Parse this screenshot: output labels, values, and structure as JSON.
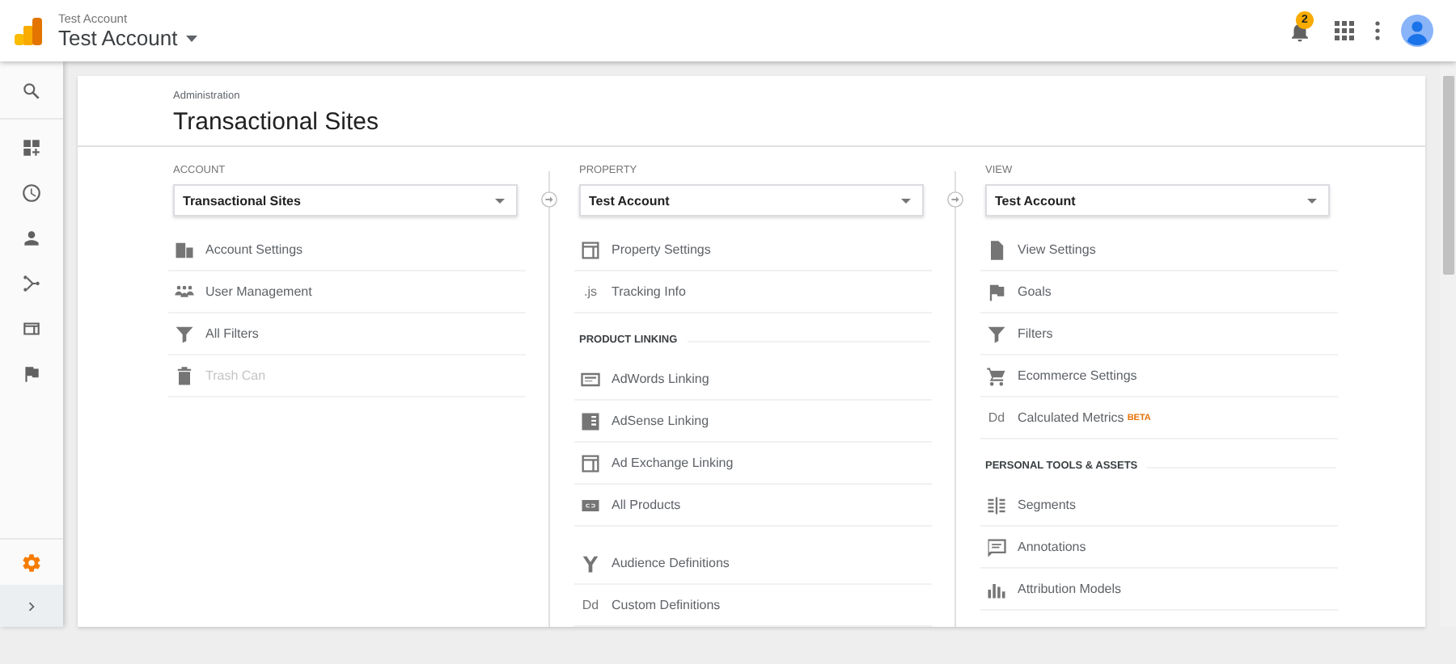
{
  "header": {
    "account_small": "Test Account",
    "account": "Test Account",
    "notifications": "2"
  },
  "sidebar": {
    "items": [
      {
        "selected": false
      },
      {
        "selected": false
      },
      {
        "selected": false
      },
      {
        "selected": false
      },
      {
        "selected": false
      },
      {
        "selected": false
      },
      {
        "selected": false
      },
      {
        "selected": true
      }
    ]
  },
  "admin": {
    "breadcrumb": "Administration",
    "title": "Transactional Sites",
    "columns": [
      {
        "label": "ACCOUNT",
        "selector": "Transactional Sites",
        "groups": [
          {
            "items": [
              {
                "label": "Account Settings",
                "disabled": false
              },
              {
                "label": "User Management",
                "disabled": false
              },
              {
                "label": "All Filters",
                "disabled": false
              },
              {
                "label": "Trash Can",
                "disabled": true
              }
            ]
          }
        ]
      },
      {
        "label": "PROPERTY",
        "selector": "Test Account",
        "groups": [
          {
            "items": [
              {
                "label": "Property Settings",
                "disabled": false
              },
              {
                "label": "Tracking Info",
                "disabled": false,
                "icon_text": ".js"
              }
            ]
          },
          {
            "heading": "PRODUCT LINKING",
            "items": [
              {
                "label": "AdWords Linking",
                "disabled": false
              },
              {
                "label": "AdSense Linking",
                "disabled": false
              },
              {
                "label": "Ad Exchange Linking",
                "disabled": false
              },
              {
                "label": "All Products",
                "disabled": false
              }
            ]
          },
          {
            "items": [
              {
                "label": "Audience Definitions",
                "disabled": false
              },
              {
                "label": "Custom Definitions",
                "disabled": false,
                "icon_text": "Dd"
              }
            ]
          }
        ]
      },
      {
        "label": "VIEW",
        "selector": "Test Account",
        "groups": [
          {
            "items": [
              {
                "label": "View Settings",
                "disabled": false
              },
              {
                "label": "Goals",
                "disabled": false
              },
              {
                "label": "Filters",
                "disabled": false
              },
              {
                "label": "Ecommerce Settings",
                "disabled": false
              },
              {
                "label": "Calculated Metrics",
                "disabled": false,
                "icon_text": "Dd",
                "badge": "BETA"
              }
            ]
          },
          {
            "heading": "PERSONAL TOOLS & ASSETS",
            "items": [
              {
                "label": "Segments",
                "disabled": false
              },
              {
                "label": "Annotations",
                "disabled": false
              },
              {
                "label": "Attribution Models",
                "disabled": false
              }
            ]
          }
        ]
      }
    ]
  }
}
